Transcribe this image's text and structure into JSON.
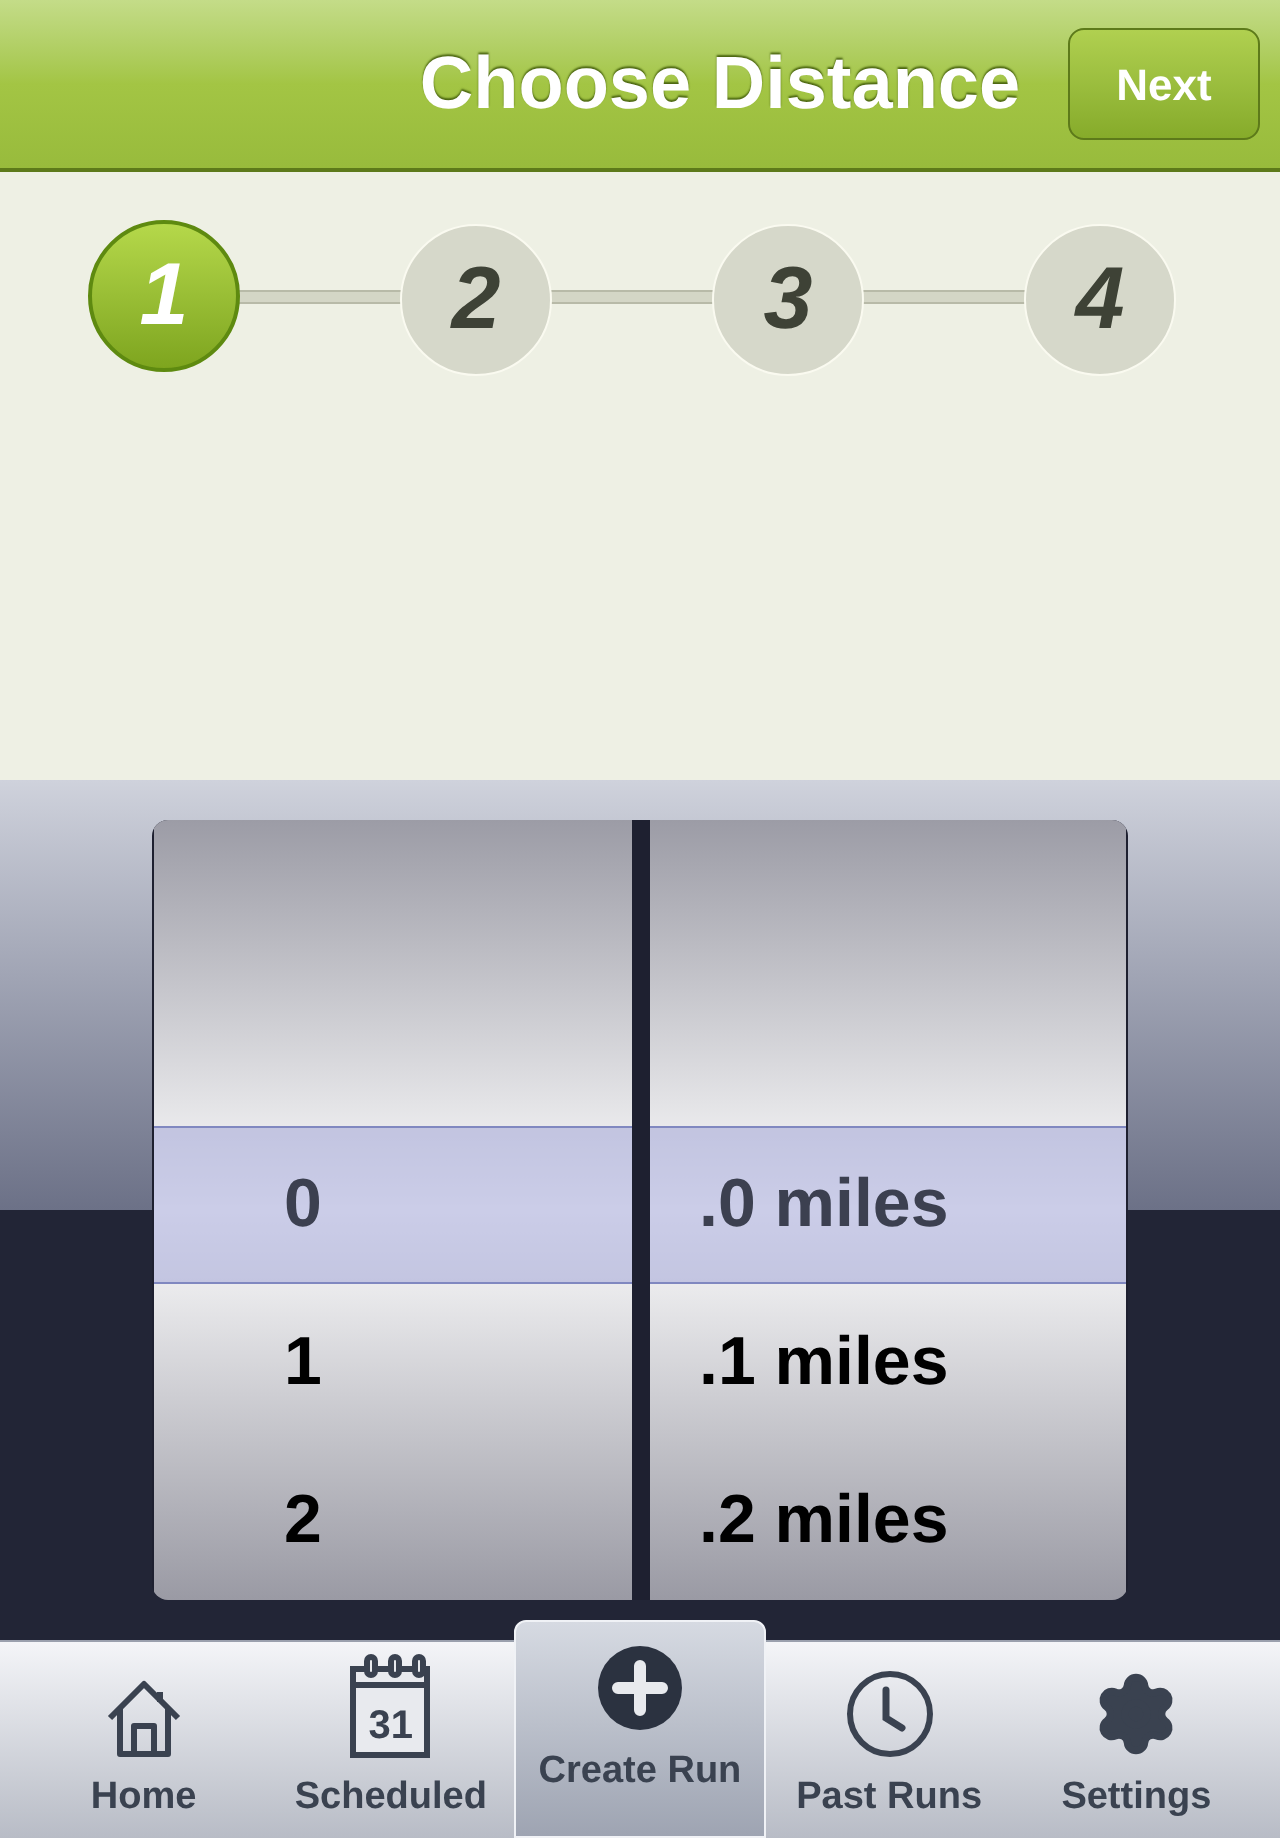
{
  "header": {
    "title": "Choose Distance",
    "next_button": "Next"
  },
  "steps": [
    {
      "label": "1",
      "selected": true
    },
    {
      "label": "2",
      "selected": false
    },
    {
      "label": "3",
      "selected": false
    },
    {
      "label": "4",
      "selected": false
    }
  ],
  "picker": {
    "columns": [
      {
        "rows": [
          {
            "label": "0",
            "selected": true
          },
          {
            "label": "1",
            "selected": false
          },
          {
            "label": "2",
            "selected": false
          }
        ]
      },
      {
        "rows": [
          {
            "label": ".0 miles",
            "selected": true
          },
          {
            "label": ".1 miles",
            "selected": false
          },
          {
            "label": ".2 miles",
            "selected": false
          }
        ]
      }
    ]
  },
  "tab_bar": [
    {
      "kind": "home",
      "label": "Home",
      "selected": false
    },
    {
      "kind": "calendar",
      "label": "Scheduled",
      "icon_text": "31",
      "selected": false
    },
    {
      "kind": "add",
      "label": "Create Run",
      "selected": true
    },
    {
      "kind": "clock",
      "label": "Past Runs",
      "selected": false
    },
    {
      "kind": "gear",
      "label": "Settings",
      "selected": false
    }
  ]
}
